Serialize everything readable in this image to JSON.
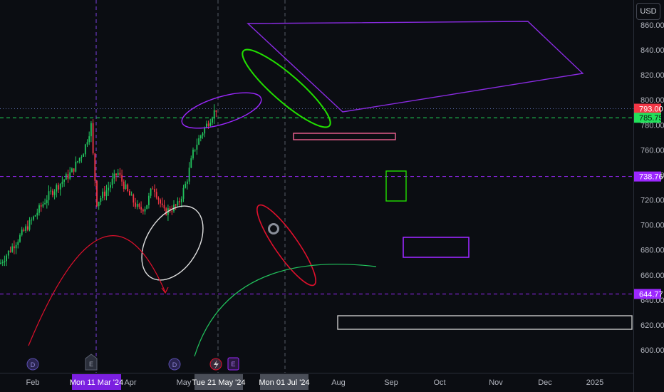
{
  "currency_button": "USD",
  "chart_data": {
    "type": "candlestick",
    "price_axis": {
      "ticks": [
        "860.00",
        "840.00",
        "820.00",
        "800.00",
        "780.00",
        "760.00",
        "740.00",
        "720.00",
        "700.00",
        "680.00",
        "660.00",
        "640.00",
        "620.00",
        "600.00"
      ],
      "range": [
        590,
        862
      ]
    },
    "time_axis": {
      "ticks": [
        "Feb",
        "Apr",
        "May",
        "Aug",
        "Sep",
        "Oct",
        "Nov",
        "Dec",
        "2025"
      ]
    },
    "price_tags": [
      {
        "label": "793.00",
        "price": 793.0,
        "color": "#f23645",
        "text": "light"
      },
      {
        "label": "785.75",
        "price": 785.75,
        "color": "#22e05a",
        "text": "dark"
      },
      {
        "label": "738.76",
        "price": 738.76,
        "color": "#9c27ff",
        "text": "light"
      },
      {
        "label": "644.77",
        "price": 644.77,
        "color": "#9c27ff",
        "text": "light"
      }
    ],
    "date_tags": [
      {
        "label": "Mon 11 Mar '24",
        "color": "#7b1fe0"
      },
      {
        "label": "Tue 21 May '24",
        "color": "#4a4e58"
      },
      {
        "label": "Mon 01 Jul '24",
        "color": "#4a4e58"
      }
    ],
    "horizontal_lines": [
      {
        "price": 785.75,
        "color": "#22e05a",
        "style": "dashed"
      },
      {
        "price": 738.76,
        "color": "#9c27ff",
        "style": "dashed"
      },
      {
        "price": 644.77,
        "color": "#9c27ff",
        "style": "dashed"
      },
      {
        "price": 793.0,
        "color": "#5a6aa8",
        "style": "dotted"
      }
    ],
    "event_markers": [
      "D",
      "E",
      "D",
      "E"
    ],
    "colors": {
      "up": "#22c55e",
      "down": "#f23645",
      "background": "#0b0d12"
    }
  }
}
